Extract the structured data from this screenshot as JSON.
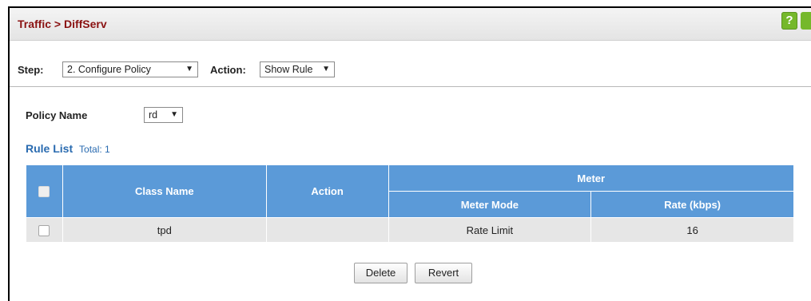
{
  "header": {
    "title": "Traffic > DiffServ",
    "help_label": "?"
  },
  "toolbar": {
    "step_label": "Step:",
    "step_value": "2. Configure Policy",
    "action_label": "Action:",
    "action_value": "Show Rule"
  },
  "policy": {
    "label": "Policy Name",
    "value": "rd"
  },
  "rule_list": {
    "title": "Rule List",
    "total": "Total: 1",
    "headers": {
      "class_name": "Class Name",
      "action": "Action",
      "meter": "Meter",
      "meter_mode": "Meter Mode",
      "rate": "Rate (kbps)"
    },
    "rows": [
      {
        "class_name": "tpd",
        "action": "",
        "meter_mode": "Rate Limit",
        "rate": "16"
      }
    ]
  },
  "buttons": {
    "delete": "Delete",
    "revert": "Revert"
  },
  "colors": {
    "title": "#8a1212",
    "accent": "#2a6bb0",
    "table_header": "#5b9ad8",
    "help": "#75b82b"
  }
}
